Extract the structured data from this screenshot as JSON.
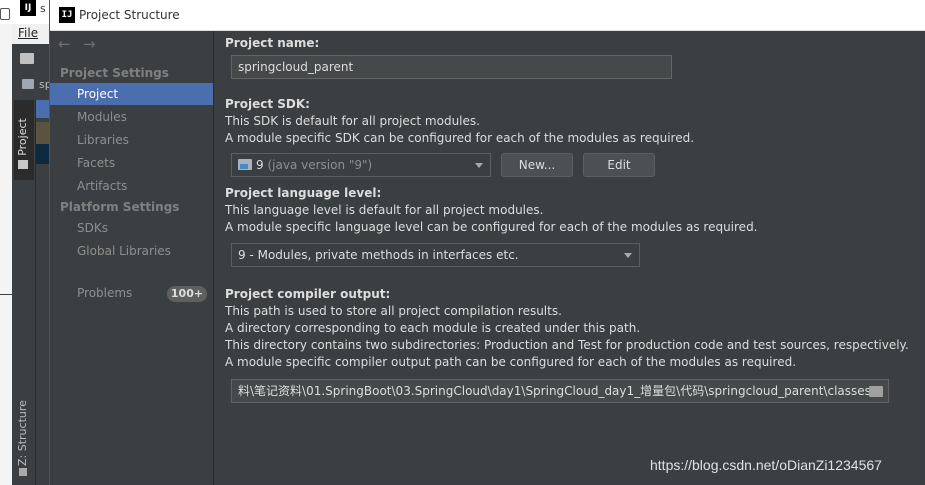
{
  "background_ide": {
    "title_fragment": "s",
    "app_icon": "IJ",
    "file_menu": "File",
    "project_tab_label": "1: Project",
    "structure_tab_label": "Z: Structure",
    "project_item_fragment": "sp"
  },
  "dialog": {
    "title": "Project Structure",
    "title_icon": "IJ"
  },
  "sidebar": {
    "back_icon": "←",
    "forward_icon": "→",
    "project_settings_label": "Project Settings",
    "project_settings_items": [
      "Project",
      "Modules",
      "Libraries",
      "Facets",
      "Artifacts"
    ],
    "platform_settings_label": "Platform Settings",
    "platform_settings_items": [
      "SDKs",
      "Global Libraries"
    ],
    "problems_label": "Problems",
    "problems_count": "100+",
    "selected_item": "Project"
  },
  "content": {
    "project_name": {
      "heading": "Project name:",
      "value": "springcloud_parent"
    },
    "project_sdk": {
      "heading": "Project SDK:",
      "desc_lines": [
        "This SDK is default for all project modules.",
        "A module specific SDK can be configured for each of the modules as required."
      ],
      "selected_value": "9",
      "selected_detail": "(java version \"9\")",
      "new_button": "New...",
      "edit_button": "Edit"
    },
    "language_level": {
      "heading": "Project language level:",
      "desc_lines": [
        "This language level is default for all project modules.",
        "A module specific language level can be configured for each of the modules as required."
      ],
      "selected_value": "9 - Modules, private methods in interfaces etc."
    },
    "compiler_output": {
      "heading": "Project compiler output:",
      "desc_lines": [
        "This path is used to store all project compilation results.",
        "A directory corresponding to each module is created under this path.",
        "This directory contains two subdirectories: Production and Test for production code and test sources, respectively.",
        "A module specific compiler output path can be configured for each of the modules as required."
      ],
      "path": "料\\笔记资料\\01.SpringBoot\\03.SpringCloud\\day1\\SpringCloud_day1_增量包\\代码\\springcloud_parent\\classes"
    }
  },
  "watermark": "https://blog.csdn.net/oDianZi1234567",
  "colors": {
    "dialog_bg": "#3c3f41",
    "selection": "#4b6eaf",
    "text": "#dddddd",
    "muted_text": "#8f8f8f"
  }
}
